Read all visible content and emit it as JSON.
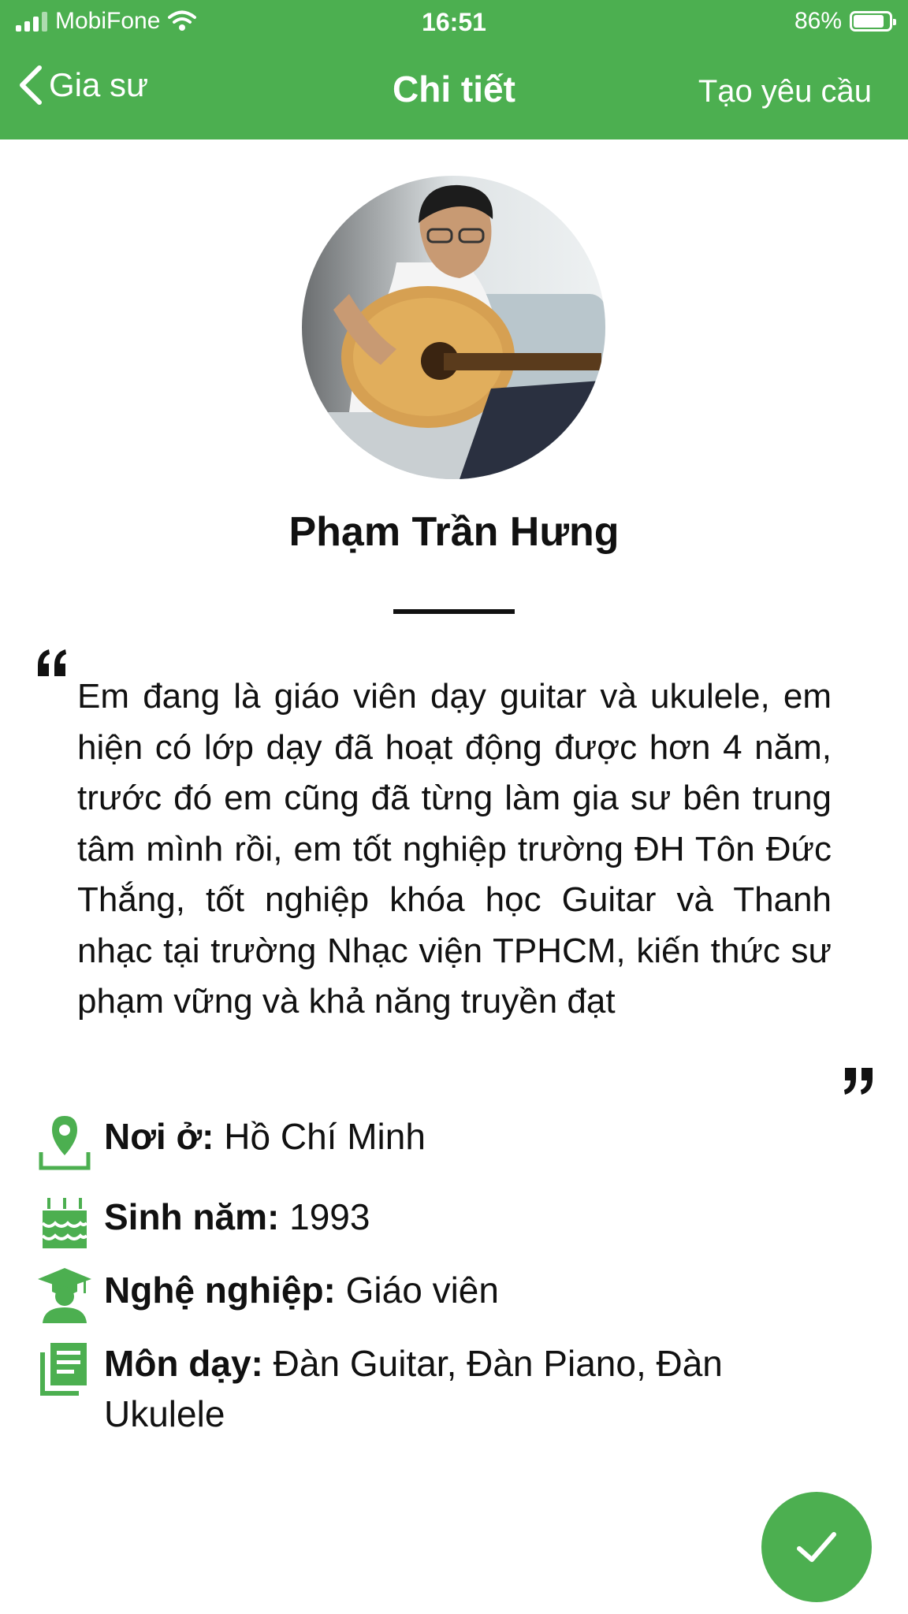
{
  "status_bar": {
    "carrier": "MobiFone",
    "time": "16:51",
    "battery": "86%",
    "battery_level": 0.86,
    "signal_icon": "signal-bars-icon",
    "wifi_icon": "wifi-icon"
  },
  "nav": {
    "back_label": "Gia sư",
    "title": "Chi tiết",
    "action_label": "Tạo yêu cầu"
  },
  "profile": {
    "name": "Phạm Trần Hưng",
    "bio": "Em đang là giáo viên dạy guitar và ukulele, em hiện có lớp dạy đã hoạt động được hơn 4 năm, trước đó em cũng đã từng làm gia sư bên trung tâm mình rồi, em tốt nghiệp trường ĐH Tôn Đức Thắng, tốt nghiệp khóa học Guitar và Thanh nhạc tại trường Nhạc viện TPHCM, kiến thức sư phạm vững và khả năng truyền đạt",
    "details": [
      {
        "icon": "location-pin-icon",
        "label": "Nơi ở:",
        "value": "Hồ Chí Minh"
      },
      {
        "icon": "birthday-cake-icon",
        "label": "Sinh năm:",
        "value": "1993"
      },
      {
        "icon": "graduate-icon",
        "label": "Nghệ nghiệp:",
        "value": "Giáo viên"
      },
      {
        "icon": "subjects-list-icon",
        "label": "Môn dạy:",
        "value": "Đàn Guitar, Đàn Piano, Đàn Ukulele"
      }
    ]
  },
  "colors": {
    "accent": "#4caf50",
    "text": "#111111",
    "background": "#ffffff"
  }
}
